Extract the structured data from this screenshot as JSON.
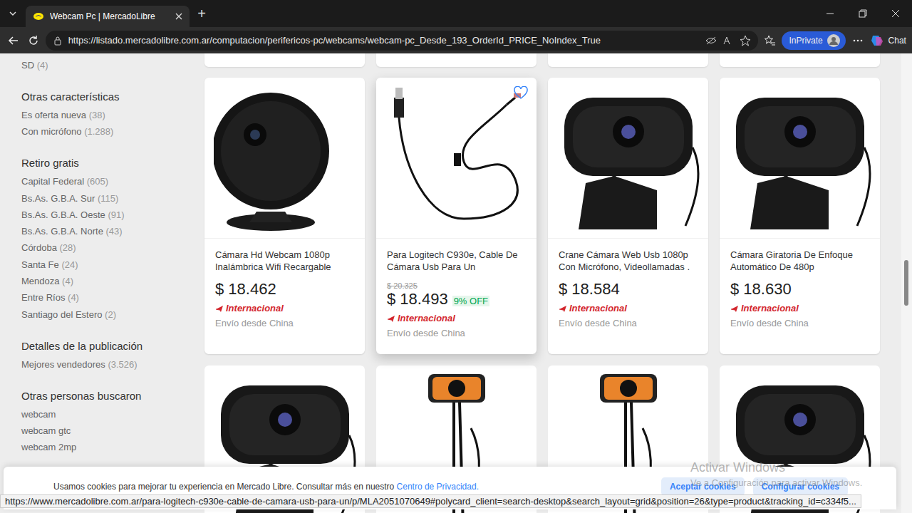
{
  "window": {
    "tab_title": "Webcam Pc | MercadoLibre",
    "new_tab": "+"
  },
  "address_bar": {
    "url": "https://listado.mercadolibre.com.ar/computacion/perifericos-pc/webcams/webcam-pc_Desde_193_OrderId_PRICE_NoIndex_True"
  },
  "toolbar": {
    "inprivate": "InPrivate",
    "chat": "Chat"
  },
  "sidebar": {
    "sections": [
      {
        "title": "",
        "items": [
          {
            "label": "SD",
            "count": "(4)"
          }
        ]
      },
      {
        "title": "Otras características",
        "items": [
          {
            "label": "Es oferta nueva",
            "count": "(38)"
          },
          {
            "label": "Con micrófono",
            "count": "(1.288)"
          }
        ]
      },
      {
        "title": "Retiro gratis",
        "items": [
          {
            "label": "Capital Federal",
            "count": "(605)"
          },
          {
            "label": "Bs.As. G.B.A. Sur",
            "count": "(115)"
          },
          {
            "label": "Bs.As. G.B.A. Oeste",
            "count": "(91)"
          },
          {
            "label": "Bs.As. G.B.A. Norte",
            "count": "(43)"
          },
          {
            "label": "Córdoba",
            "count": "(28)"
          },
          {
            "label": "Santa Fe",
            "count": "(24)"
          },
          {
            "label": "Mendoza",
            "count": "(4)"
          },
          {
            "label": "Entre Ríos",
            "count": "(4)"
          },
          {
            "label": "Santiago del Estero",
            "count": "(2)"
          }
        ]
      },
      {
        "title": "Detalles de la publicación",
        "items": [
          {
            "label": "Mejores vendedores",
            "count": "(3.526)"
          }
        ]
      },
      {
        "title": "Otras personas buscaron",
        "items": [
          {
            "label": "webcam",
            "count": ""
          },
          {
            "label": "webcam gtc",
            "count": ""
          },
          {
            "label": "webcam 2mp",
            "count": ""
          }
        ]
      }
    ]
  },
  "top_row": [
    {
      "hovered": false
    },
    {
      "hovered": false
    },
    {
      "hovered": false
    },
    {
      "hovered": false
    }
  ],
  "products": [
    {
      "kind": "round-cam",
      "title": "Cámara Hd Webcam 1080p Inalámbrica Wifi Recargable",
      "original_price": "",
      "price": "$ 18.462",
      "discount": "",
      "tag": "Internacional",
      "shipping": "Envío desde China",
      "hovered": false
    },
    {
      "kind": "cable",
      "title": "Para Logitech C930e, Cable De Cámara Usb Para Un",
      "original_price": "$ 20.325",
      "price": "$ 18.493",
      "discount": "9% OFF",
      "tag": "Internacional",
      "shipping": "Envío desde China",
      "hovered": true
    },
    {
      "kind": "webcam",
      "title": "Crane Cámara Web Usb 1080p Con Micrófono, Videollamadas .",
      "original_price": "",
      "price": "$ 18.584",
      "discount": "",
      "tag": "Internacional",
      "shipping": "Envío desde China",
      "hovered": false
    },
    {
      "kind": "webcam",
      "title": "Cámara Giratoria De Enfoque Automático De 480p",
      "original_price": "",
      "price": "$ 18.630",
      "discount": "",
      "tag": "Internacional",
      "shipping": "Envío desde China",
      "hovered": false
    }
  ],
  "second_row": [
    {
      "kind": "webcam"
    },
    {
      "kind": "gooseneck"
    },
    {
      "kind": "gooseneck"
    },
    {
      "kind": "webcam"
    }
  ],
  "cookie_banner": {
    "text": "Usamos cookies para mejorar tu experiencia en Mercado Libre. Consultar más en nuestro ",
    "link": "Centro de Privacidad.",
    "buttons": [
      "Aceptar cookies",
      "Configurar cookies"
    ]
  },
  "status_url": "https://www.mercadolibre.com.ar/para-logitech-c930e-cable-de-camara-usb-para-un/p/MLA2051070649#polycard_client=search-desktop&search_layout=grid&position=26&type=product&tracking_id=c334f5...",
  "watermark": {
    "title": "Activar Windows",
    "subtitle": "Ve a Configuración para activar Windows."
  }
}
